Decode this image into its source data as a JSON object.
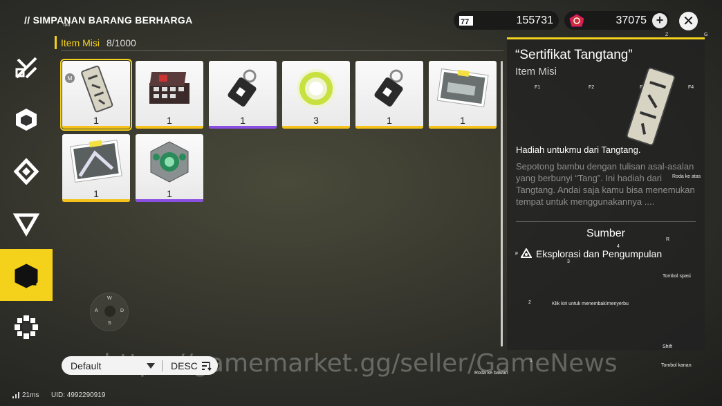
{
  "header": {
    "title": "// SIMPANAN BARANG BERHARGA",
    "tab_hint": "Tab",
    "currency_1": {
      "value": "155731",
      "icon": "battery-pass-icon"
    },
    "currency_2": {
      "value": "37075",
      "icon": "crystal-gem-icon"
    },
    "plus_label": "+",
    "close_label": "✕",
    "hint_z": "Z",
    "hint_g": "G"
  },
  "sidebar": {
    "items": [
      {
        "icon": "combat-crossed-icon",
        "active": false
      },
      {
        "icon": "cube-icon",
        "active": false
      },
      {
        "icon": "hex-shield-icon",
        "active": false
      },
      {
        "icon": "triangle-icon",
        "active": false
      },
      {
        "icon": "box-alert-icon",
        "active": true
      },
      {
        "icon": "gear-flower-icon",
        "active": false
      }
    ]
  },
  "category": {
    "name": "Item Misi",
    "count": "8/1000"
  },
  "items": [
    {
      "name": "bamboo-tag",
      "qty": "1",
      "rarity": "#f4c21b",
      "badge": "M",
      "selected": true
    },
    {
      "name": "toolbox",
      "qty": "1",
      "rarity": "#f4c21b"
    },
    {
      "name": "keychain-tag-purple",
      "qty": "1",
      "rarity": "#8a4fe0"
    },
    {
      "name": "glowing-ring",
      "qty": "3",
      "rarity": "#f4c21b"
    },
    {
      "name": "keychain-tag",
      "qty": "1",
      "rarity": "#f4c21b"
    },
    {
      "name": "photo-1",
      "qty": "1",
      "rarity": "#f4c21b"
    },
    {
      "name": "photo-2",
      "qty": "1",
      "rarity": "#f4c21b"
    },
    {
      "name": "green-cube-device",
      "qty": "1",
      "rarity": "#8a4fe0"
    }
  ],
  "detail": {
    "title": "“Sertifikat Tangtang”",
    "type": "Item Misi",
    "subtitle": "Hadiah untukmu dari Tangtang.",
    "description": "Sepotong bambu dengan tulisan asal-asalan yang berbunyi “Tang”. Ini hadiah dari Tangtang. Andai saja kamu bisa menemukan tempat untuk menggunakannya ....",
    "source_header": "Sumber",
    "source_item": "Eksplorasi dan Pengumpulan",
    "hints": {
      "f1": "F1",
      "f2": "F2",
      "f3": "F3",
      "f4": "F4"
    }
  },
  "overlay_hints": {
    "roda_ke_atas": "Roda ke atas",
    "r": "R",
    "four": "4",
    "f": "F",
    "three": "3",
    "tombol_spasi": "Tombol spasi",
    "two": "2",
    "klik_kiri": "Klik kiri untuk menembak/menyerbu",
    "shift": "Shift",
    "one": "1",
    "tombol_kanan": "Tombol kanan",
    "roda_ke_bawah": "Roda ke bawah"
  },
  "joystick": {
    "w": "W",
    "a": "A",
    "s": "S",
    "d": "D"
  },
  "sort": {
    "selected": "Default",
    "direction": "DESC"
  },
  "footer": {
    "ping": "21ms",
    "uid": "UID: 4992290919"
  },
  "watermark": "https://gamemarket.gg/seller/GameNews",
  "colors": {
    "accent": "#f4d21b",
    "purple": "#8a4fe0"
  }
}
